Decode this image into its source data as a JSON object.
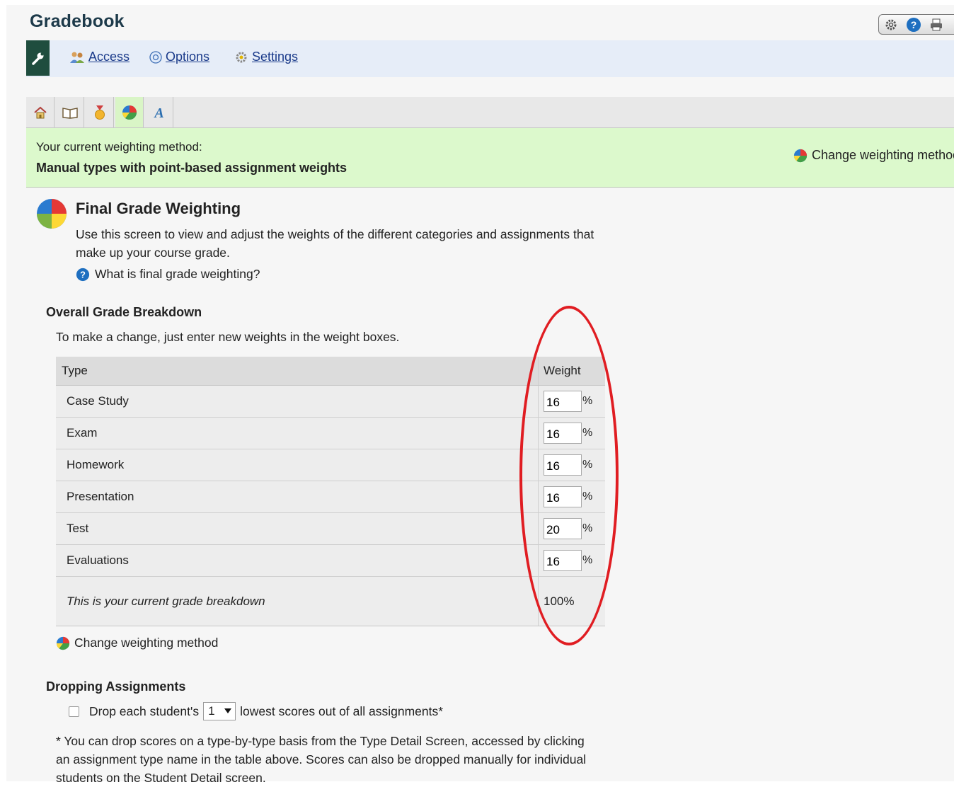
{
  "app": {
    "title": "Gradebook"
  },
  "header_tools": [
    "gear-icon",
    "help-icon",
    "print-icon"
  ],
  "toolbar": {
    "access_label": "Access",
    "options_label": "Options",
    "settings_label": "Settings"
  },
  "tabs": [
    {
      "icon": "home-icon"
    },
    {
      "icon": "book-icon"
    },
    {
      "icon": "medal-icon"
    },
    {
      "icon": "pie-chart-icon",
      "active": true
    },
    {
      "icon": "letter-a-icon"
    }
  ],
  "banner": {
    "label": "Your current weighting method:",
    "value": "Manual types with point-based assignment weights",
    "change_link": "Change weighting method"
  },
  "section": {
    "title": "Final Grade Weighting",
    "description": "Use this screen to view and adjust the weights of the different categories and assignments that make up your course grade.",
    "help_link": "What is final grade weighting?"
  },
  "overall": {
    "heading": "Overall Grade Breakdown",
    "intro": "To make a change, just enter new weights in the weight boxes.",
    "columns": {
      "type": "Type",
      "weight": "Weight"
    },
    "rows": [
      {
        "type": "Case Study",
        "weight": "16"
      },
      {
        "type": "Exam",
        "weight": "16"
      },
      {
        "type": "Homework",
        "weight": "16"
      },
      {
        "type": "Presentation",
        "weight": "16"
      },
      {
        "type": "Test",
        "weight": "20"
      },
      {
        "type": "Evaluations",
        "weight": "16"
      }
    ],
    "percent_symbol": "%",
    "total_label": "This is your current grade breakdown",
    "total_value": "100%",
    "change_link": "Change weighting method"
  },
  "dropping": {
    "heading": "Dropping Assignments",
    "checked": false,
    "label_before": "Drop each student's",
    "select_value": "1",
    "label_after": "lowest scores out of all assignments*",
    "footnote": "* You can drop scores on a type-by-type basis from the Type Detail Screen, accessed by clicking an assignment type name in the table above. Scores can also be dropped manually for individual students on the Student Detail screen."
  },
  "annotation": {
    "color": "#e01d22"
  }
}
